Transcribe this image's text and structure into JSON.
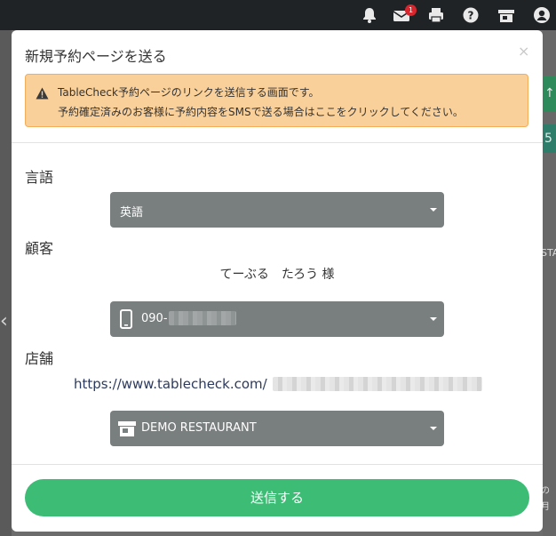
{
  "topbar": {
    "icons": [
      "bell-icon",
      "mail-icon",
      "print-icon",
      "help-icon",
      "store-icon",
      "user-icon"
    ],
    "mail_badge": "1"
  },
  "modal": {
    "title": "新規予約ページを送る",
    "close_label": "×",
    "alert": {
      "line1": "TableCheck予約ページのリンクを送信する画面です。",
      "line2": "予約確定済みのお客様に予約内容をSMSで送る場合はここをクリックしてください。"
    },
    "language": {
      "label": "言語",
      "selected": "英語"
    },
    "customer": {
      "label": "顧客",
      "name": "てーぶる　たろう 様",
      "phone_prefix": "090-"
    },
    "store": {
      "label": "店舗",
      "url_prefix": "https://www.tablecheck.com/",
      "selected": "DEMO RESTAURANT"
    },
    "send_label": "送信する"
  },
  "background": {
    "green_digit": "5",
    "partial_text": "STA",
    "misc_line1": "の",
    "misc_line2": "月"
  },
  "colors": {
    "accent_green": "#3cbc74",
    "alert_bg": "#fad09a",
    "select_bg": "#797e7e",
    "topbar_bg": "#202326"
  }
}
